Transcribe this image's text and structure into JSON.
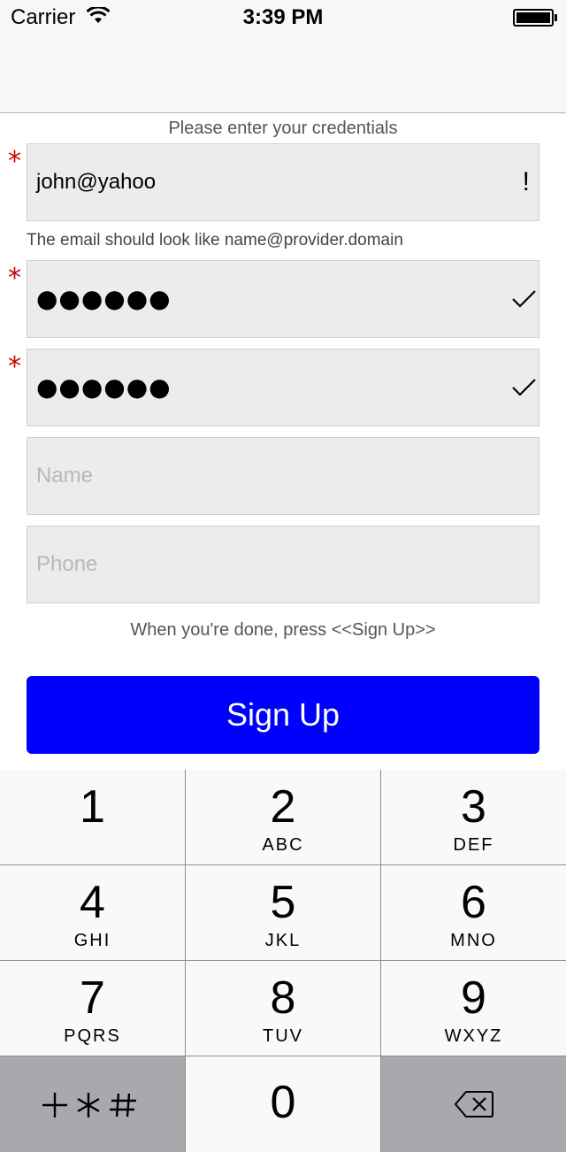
{
  "status_bar": {
    "carrier": "Carrier",
    "time": "3:39 PM"
  },
  "form": {
    "header_hint": "Please enter your credentials",
    "required_mark": "*",
    "email": {
      "value": "john@yahoo",
      "status_icon": "!"
    },
    "email_hint": "The email should look like name@provider.domain",
    "password": {
      "value": "●●●●●●",
      "status_icon": "checkmark-icon"
    },
    "confirm_password": {
      "value": "●●●●●●",
      "status_icon": "checkmark-icon"
    },
    "name": {
      "placeholder": "Name"
    },
    "phone": {
      "placeholder": "Phone"
    },
    "footer_hint": "When you're done, press <<Sign Up>>",
    "signup_label": "Sign Up"
  },
  "keyboard": {
    "keys": [
      {
        "num": "1",
        "letters": ""
      },
      {
        "num": "2",
        "letters": "ABC"
      },
      {
        "num": "3",
        "letters": "DEF"
      },
      {
        "num": "4",
        "letters": "GHI"
      },
      {
        "num": "5",
        "letters": "JKL"
      },
      {
        "num": "6",
        "letters": "MNO"
      },
      {
        "num": "7",
        "letters": "PQRS"
      },
      {
        "num": "8",
        "letters": "TUV"
      },
      {
        "num": "9",
        "letters": "WXYZ"
      },
      {
        "num": "0",
        "letters": ""
      }
    ],
    "symbols_key": "+*#",
    "delete_key_icon": "backspace-icon"
  }
}
